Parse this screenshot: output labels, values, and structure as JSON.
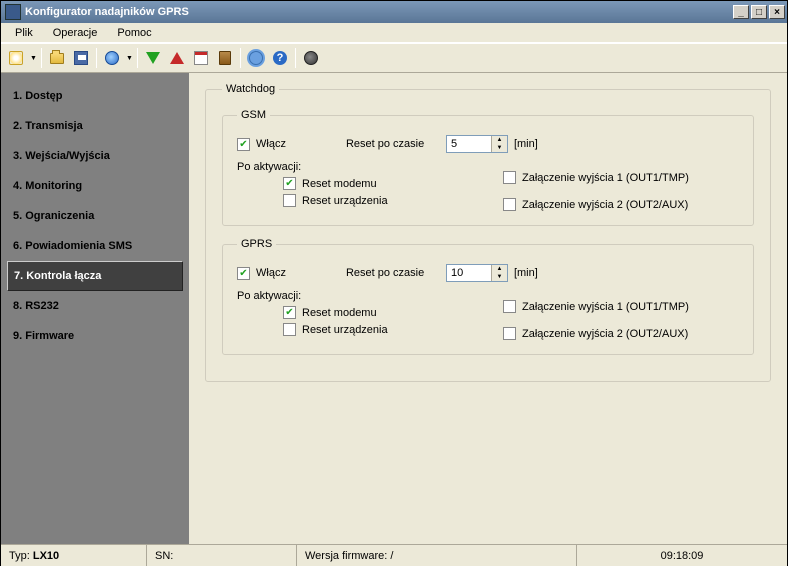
{
  "window": {
    "title": "Konfigurator nadajników GPRS"
  },
  "menu": {
    "file": "Plik",
    "operations": "Operacje",
    "help": "Pomoc"
  },
  "sidebar": {
    "items": [
      "1. Dostęp",
      "2. Transmisja",
      "3. Wejścia/Wyjścia",
      "4. Monitoring",
      "5. Ograniczenia",
      "6. Powiadomienia SMS",
      "7. Kontrola łącza",
      "8. RS232",
      "9. Firmware"
    ],
    "selected_index": 6
  },
  "panel": {
    "watchdog_legend": "Watchdog",
    "gsm": {
      "legend": "GSM",
      "enable": "Włącz",
      "enable_checked": true,
      "reset_after_label": "Reset po czasie",
      "reset_after_value": "5",
      "unit": "[min]",
      "after_activation": "Po aktywacji:",
      "reset_modem": "Reset modemu",
      "reset_modem_checked": true,
      "reset_device": "Reset urządzenia",
      "reset_device_checked": false,
      "out1": "Załączenie wyjścia 1 (OUT1/TMP)",
      "out1_checked": false,
      "out2": "Załączenie wyjścia 2 (OUT2/AUX)",
      "out2_checked": false
    },
    "gprs": {
      "legend": "GPRS",
      "enable": "Włącz",
      "enable_checked": true,
      "reset_after_label": "Reset po czasie",
      "reset_after_value": "10",
      "unit": "[min]",
      "after_activation": "Po aktywacji:",
      "reset_modem": "Reset modemu",
      "reset_modem_checked": true,
      "reset_device": "Reset urządzenia",
      "reset_device_checked": false,
      "out1": "Załączenie wyjścia 1 (OUT1/TMP)",
      "out1_checked": false,
      "out2": "Załączenie wyjścia 2 (OUT2/AUX)",
      "out2_checked": false
    }
  },
  "status": {
    "type_label": "Typ:",
    "type_value": "LX10",
    "sn_label": "SN:",
    "fw_label": "Wersja firmware: /",
    "time": "09:18:09"
  }
}
